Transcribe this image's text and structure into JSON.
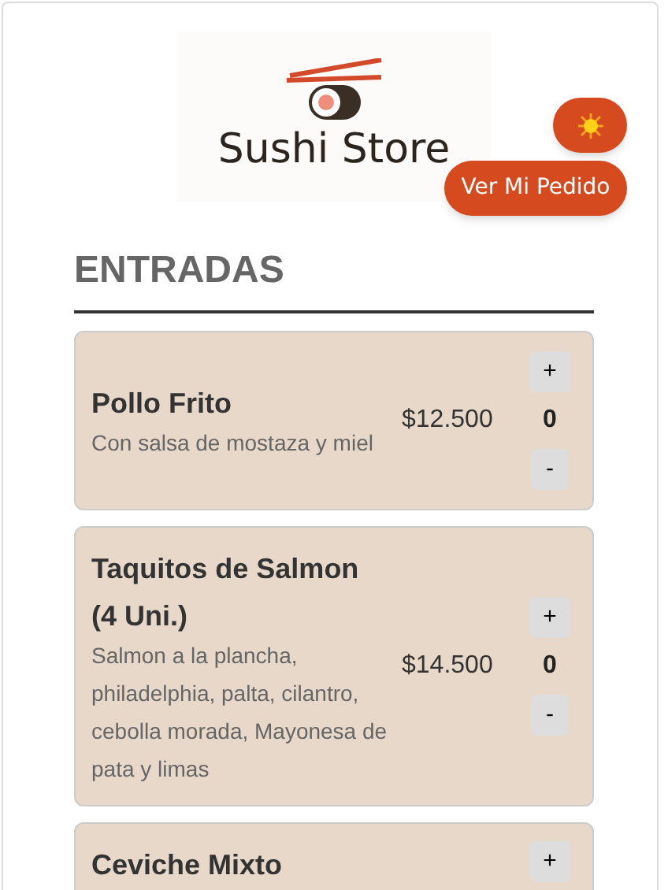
{
  "logo": {
    "text": "Sushi Store"
  },
  "order_button": {
    "label": "Ver Mi Pedido"
  },
  "section": {
    "title": "ENTRADAS"
  },
  "items": [
    {
      "name": "Pollo Frito",
      "description": "Con salsa de mostaza y miel",
      "price": "$12.500",
      "quantity": "0",
      "plus_label": "+",
      "minus_label": "-"
    },
    {
      "name": "Taquitos de Salmon (4 Uni.)",
      "description": "Salmon a la plancha, philadelphia, palta, cilantro, cebolla morada, Mayonesa de pata y limas",
      "price": "$14.500",
      "quantity": "0",
      "plus_label": "+",
      "minus_label": "-"
    },
    {
      "name": "Ceviche Mixto",
      "plus_label": "+"
    }
  ]
}
